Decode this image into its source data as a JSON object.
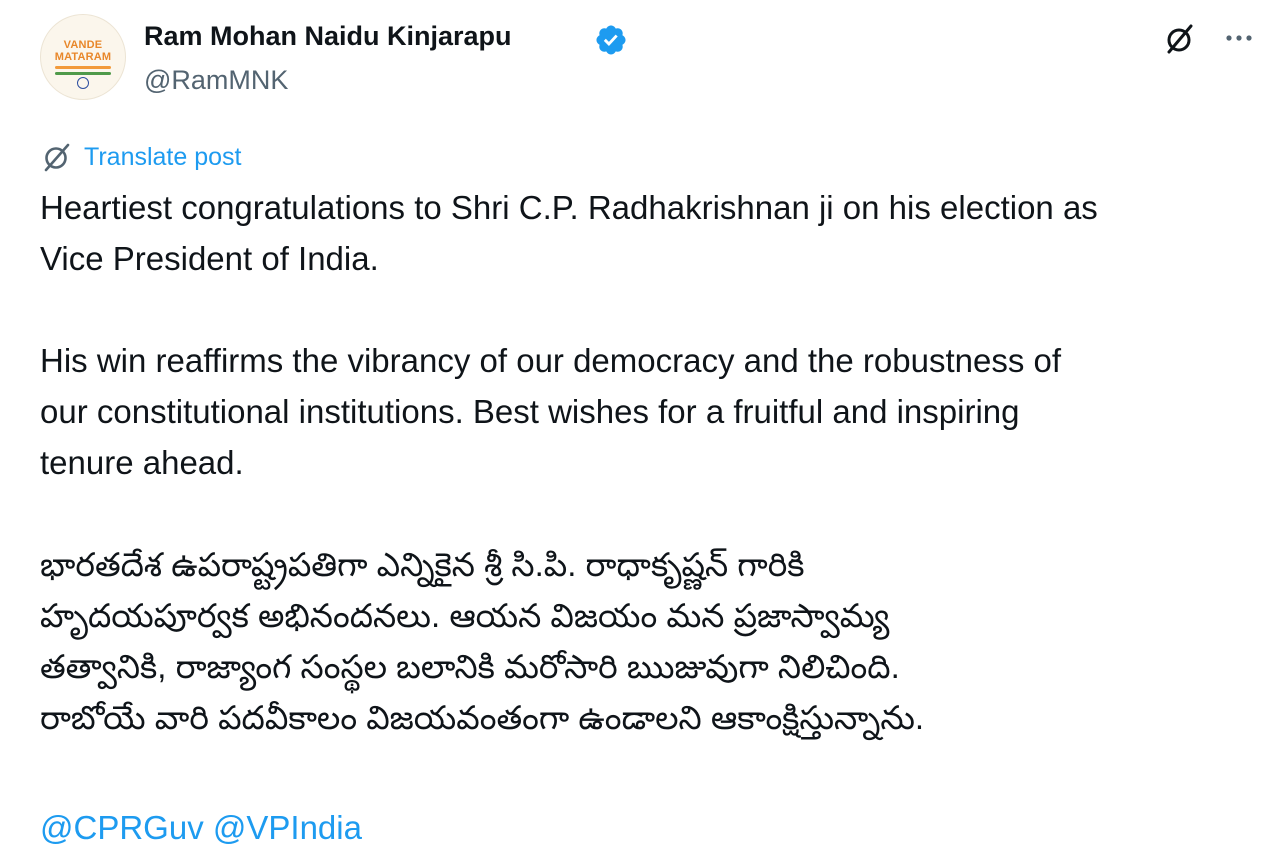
{
  "author": {
    "display_name": "Ram Mohan Naidu Kinjarapu",
    "handle": "@RamMNK",
    "verified": true,
    "avatar_text": [
      "VANDE",
      "MATARAM"
    ]
  },
  "actions": {
    "grok_icon": "grok-icon",
    "more_icon": "more-icon"
  },
  "translate": {
    "label": "Translate post",
    "icon": "translate-icon"
  },
  "post": {
    "paragraphs": [
      {
        "lines": [
          "Heartiest congratulations to Shri C.P. Radhakrishnan ji on his election as",
          "Vice President of India."
        ]
      },
      {
        "lines": [
          "His win reaffirms the vibrancy of our democracy and the robustness of",
          "our constitutional institutions. Best wishes for a fruitful and inspiring",
          "tenure ahead."
        ]
      },
      {
        "lines": [
          "భారతదేశ ఉపరాష్ట్రపతిగా ఎన్నికైన శ్రీ సి.పి. రాధాకృష్ణన్ గారికి",
          "హృదయపూర్వక అభినందనలు. ఆయన విజయం మన ప్రజాస్వామ్య",
          "తత్వానికి, రాజ్యాంగ సంస్థల బలానికి మరోసారి ఋజువుగా నిలిచింది.",
          "రాబోయే వారి పదవీకాలం విజయవంతంగా  ఉండాలని ఆకాంక్షిస్తున్నాను."
        ]
      }
    ],
    "mentions": [
      "@CPRGuv",
      "@VPIndia"
    ]
  },
  "colors": {
    "text_primary": "#0f1419",
    "text_secondary": "#536471",
    "accent_blue": "#1d9bf0",
    "verified_blue": "#1d9bf0",
    "background": "#ffffff"
  }
}
